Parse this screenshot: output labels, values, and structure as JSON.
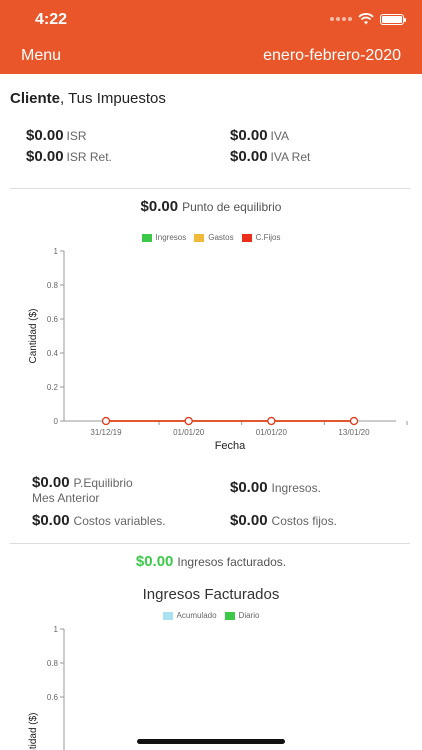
{
  "status_bar": {
    "time": "4:22"
  },
  "nav": {
    "menu_label": "Menu",
    "period": "enero-febrero-2020"
  },
  "client": {
    "label": "Cliente",
    "name": ", Tus Impuestos"
  },
  "taxes": [
    {
      "amount": "$0.00",
      "label": "ISR"
    },
    {
      "amount": "$0.00",
      "label": "IVA"
    },
    {
      "amount": "$0.00",
      "label": "ISR Ret."
    },
    {
      "amount": "$0.00",
      "label": "IVA Ret"
    }
  ],
  "breakeven": {
    "amount": "$0.00",
    "label": "Punto de equilibrio"
  },
  "chart_data": [
    {
      "type": "line",
      "title": "",
      "xlabel": "Fecha",
      "ylabel": "Cantidad ($)",
      "ylim": [
        0,
        1
      ],
      "y_ticks": [
        "0",
        "0.2",
        "0.4",
        "0.6",
        "0.8",
        "1"
      ],
      "categories": [
        "31/12/19",
        "01/01/20",
        "01/01/20",
        "13/01/20"
      ],
      "legend_position": "top-center",
      "series": [
        {
          "name": "Ingresos",
          "color": "#3cc94a",
          "values": [
            0,
            0,
            0,
            0
          ]
        },
        {
          "name": "Gastos",
          "color": "#f0b93a",
          "values": [
            0,
            0,
            0,
            0
          ]
        },
        {
          "name": "C.Fijos",
          "color": "#e8301c",
          "values": [
            0,
            0,
            0,
            0
          ]
        }
      ]
    },
    {
      "type": "bar",
      "title": "Ingresos Facturados",
      "ylabel": "Cantidad ($)",
      "ylim": [
        0,
        1
      ],
      "y_ticks": [
        "0.6",
        "0.8",
        "1"
      ],
      "legend_position": "top-center",
      "series": [
        {
          "name": "Acumulado",
          "color": "#a8e2f2"
        },
        {
          "name": "Diario",
          "color": "#3cc94a"
        }
      ]
    }
  ],
  "stats": [
    {
      "amount": "$0.00",
      "label_line1": "P.Equilibrio",
      "label_line2": "Mes Anterior"
    },
    {
      "amount": "$0.00",
      "label": "Ingresos."
    },
    {
      "amount": "$0.00",
      "label": "Costos variables."
    },
    {
      "amount": "$0.00",
      "label": "Costos fijos."
    }
  ],
  "invoiced": {
    "amount": "$0.00",
    "label": "Ingresos facturados."
  }
}
